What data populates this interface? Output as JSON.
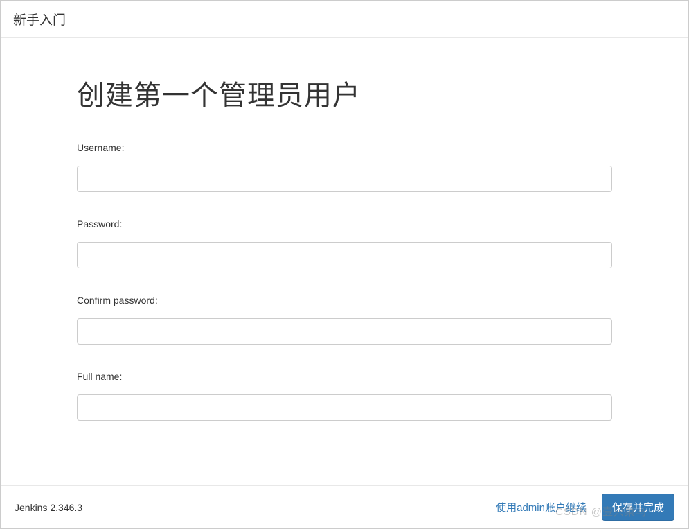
{
  "header": {
    "title": "新手入门"
  },
  "main": {
    "heading": "创建第一个管理员用户",
    "fields": {
      "username": {
        "label": "Username:",
        "value": ""
      },
      "password": {
        "label": "Password:",
        "value": ""
      },
      "confirm_password": {
        "label": "Confirm password:",
        "value": ""
      },
      "full_name": {
        "label": "Full name:",
        "value": ""
      }
    }
  },
  "footer": {
    "version": "Jenkins 2.346.3",
    "skip_link": "使用admin账户继续",
    "save_button": "保存并完成"
  },
  "watermark": "CSDN @壹只菜鸟"
}
